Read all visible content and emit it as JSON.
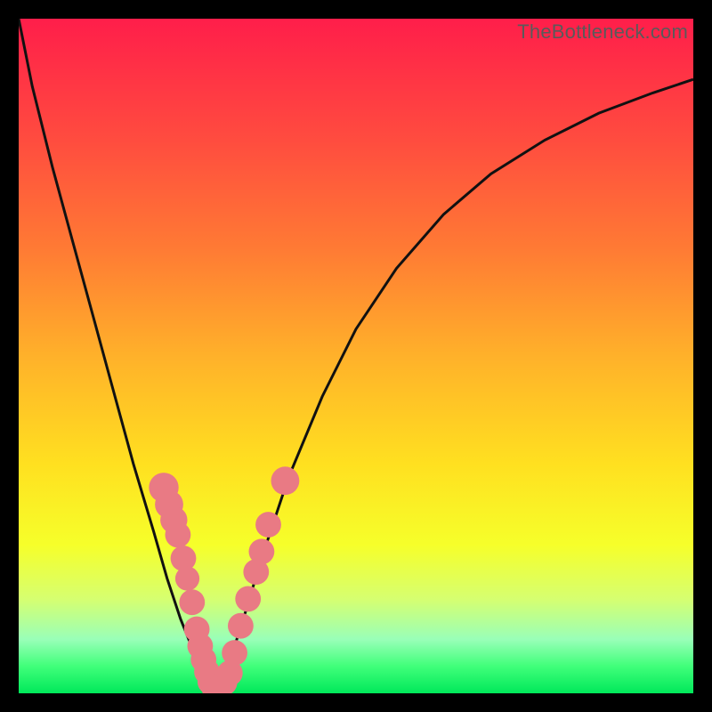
{
  "watermark": "TheBottleneck.com",
  "chart_data": {
    "type": "line",
    "title": "",
    "xlabel": "",
    "ylabel": "",
    "xlim": [
      0,
      100
    ],
    "ylim": [
      0,
      100
    ],
    "grid": false,
    "legend": false,
    "series": [
      {
        "name": "curve",
        "x": [
          0,
          2,
          5,
          8,
          11,
          14,
          17,
          20,
          22,
          24,
          26,
          27,
          28,
          29,
          30,
          31,
          33,
          36,
          40,
          45,
          50,
          56,
          63,
          70,
          78,
          86,
          94,
          100
        ],
        "y": [
          100,
          90,
          78,
          67,
          56,
          45,
          34,
          24,
          17,
          11,
          6,
          3,
          1,
          0,
          1,
          4,
          10,
          20,
          32,
          44,
          54,
          63,
          71,
          77,
          82,
          86,
          89,
          91
        ]
      }
    ],
    "markers": [
      {
        "x": 21.5,
        "y": 30.5,
        "r": 2.2
      },
      {
        "x": 22.3,
        "y": 28.0,
        "r": 2.1
      },
      {
        "x": 23.0,
        "y": 25.7,
        "r": 2.0
      },
      {
        "x": 23.6,
        "y": 23.5,
        "r": 1.9
      },
      {
        "x": 24.4,
        "y": 20.0,
        "r": 1.9
      },
      {
        "x": 25.0,
        "y": 17.0,
        "r": 1.8
      },
      {
        "x": 25.7,
        "y": 13.5,
        "r": 1.9
      },
      {
        "x": 26.4,
        "y": 9.5,
        "r": 1.9
      },
      {
        "x": 26.9,
        "y": 7.0,
        "r": 1.9
      },
      {
        "x": 27.4,
        "y": 5.0,
        "r": 1.9
      },
      {
        "x": 27.9,
        "y": 3.2,
        "r": 1.9
      },
      {
        "x": 28.4,
        "y": 1.7,
        "r": 1.9
      },
      {
        "x": 29.0,
        "y": 0.8,
        "r": 1.9
      },
      {
        "x": 29.8,
        "y": 0.9,
        "r": 1.9
      },
      {
        "x": 30.5,
        "y": 1.6,
        "r": 1.9
      },
      {
        "x": 31.3,
        "y": 3.0,
        "r": 1.9
      },
      {
        "x": 32.0,
        "y": 6.0,
        "r": 1.9
      },
      {
        "x": 32.9,
        "y": 10.0,
        "r": 1.9
      },
      {
        "x": 34.0,
        "y": 14.0,
        "r": 1.9
      },
      {
        "x": 35.2,
        "y": 18.0,
        "r": 1.9
      },
      {
        "x": 36.0,
        "y": 21.0,
        "r": 1.9
      },
      {
        "x": 37.0,
        "y": 25.0,
        "r": 1.9
      },
      {
        "x": 39.5,
        "y": 31.5,
        "r": 2.1
      }
    ],
    "marker_color": "#e97a84",
    "curve_color": "#111111",
    "curve_width": 3
  }
}
